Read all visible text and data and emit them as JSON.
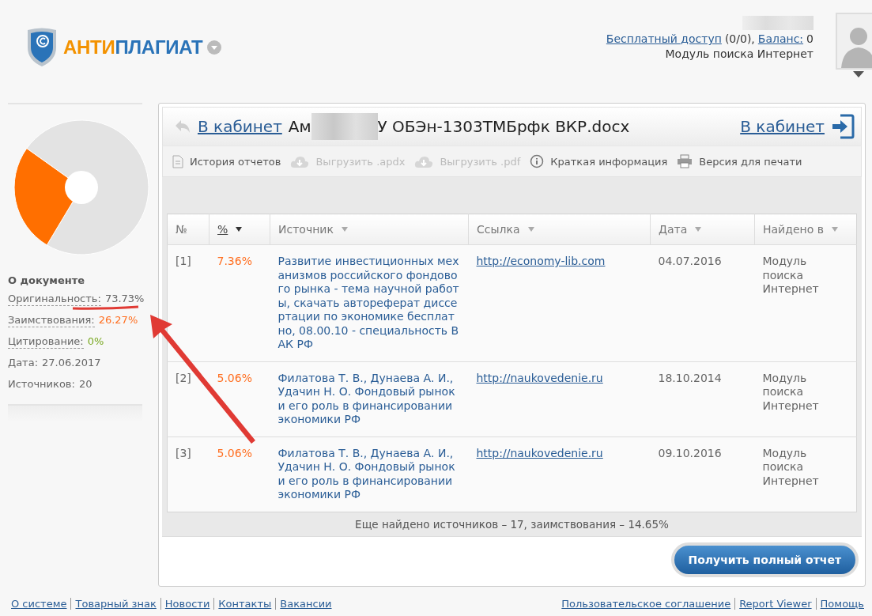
{
  "logo": {
    "text_1": "АНТИ",
    "text_2": "ПЛАГИАТ"
  },
  "header": {
    "free_access_link": "Бесплатный доступ",
    "free_access_count": "(0/0),",
    "balance_link": "Баланс:",
    "balance_value": "0",
    "module": "Модуль поиска Интернет"
  },
  "sidebar": {
    "chart_data": {
      "type": "donut",
      "values": [
        73.73,
        26.27
      ]
    },
    "heading": "О документе",
    "stats": [
      {
        "kind": "term",
        "label": "Оригинальность:",
        "value": "73.73%",
        "color": "#666666"
      },
      {
        "kind": "term",
        "label": "Заимствования:",
        "value": "26.27%",
        "color": "#ff6f21"
      },
      {
        "kind": "term",
        "label": "Цитирование:",
        "value": "0%",
        "color": "#79a821"
      },
      {
        "kind": "plain",
        "label": "Дата:",
        "value": "27.06.2017",
        "color": "#666666"
      },
      {
        "kind": "plain",
        "label": "Источников:",
        "value": "20",
        "color": "#666666"
      }
    ]
  },
  "report": {
    "back_link": "В кабинет",
    "title_start": "Ам",
    "title_end": "У ОБЭн-1303ТМБрфк ВКР.docx",
    "exit_link": "В кабинет",
    "toolbar": [
      {
        "kind": "document",
        "label": "История отчетов",
        "disabled": false
      },
      {
        "kind": "cloud",
        "label": "Выгрузить .apdx",
        "disabled": true
      },
      {
        "kind": "cloud",
        "label": "Выгрузить .pdf",
        "disabled": true
      },
      {
        "kind": "info",
        "label": "Краткая информация",
        "disabled": false
      },
      {
        "kind": "printer",
        "label": "Версия для печати",
        "disabled": false
      }
    ],
    "table": {
      "columns": [
        {
          "label": "№",
          "sortable": false,
          "selected": false
        },
        {
          "label": "%",
          "sortable": true,
          "selected": true
        },
        {
          "label": "Источник",
          "sortable": true,
          "selected": false
        },
        {
          "label": "Ссылка",
          "sortable": true,
          "selected": false
        },
        {
          "label": "Дата",
          "sortable": true,
          "selected": false
        },
        {
          "label": "Найдено в",
          "sortable": true,
          "selected": false
        }
      ],
      "rows": [
        {
          "number": "[1]",
          "percent": "7.36%",
          "source": "Развитие инвестиционных механизмов российского фондового рынка - тема научной работы, скачать автореферат диссертации по экономике бесплатно, 08.00.10 - специальность ВАК РФ",
          "link": "http://economy-lib.com",
          "date": "04.07.2016",
          "found_in": "Модуль поиска Интернет"
        },
        {
          "number": "[2]",
          "percent": "5.06%",
          "source": "Филатова Т. В., Дунаева А. И., Удачин Н. О. Фондовый рынок и его роль в финансировании экономики РФ",
          "link": "http://naukovedenie.ru",
          "date": "18.10.2014",
          "found_in": "Модуль поиска Интернет"
        },
        {
          "number": "[3]",
          "percent": "5.06%",
          "source": "Филатова Т. В., Дунаева А. И., Удачин Н. О. Фондовый рынок и его роль в финансировании экономики РФ",
          "link": "http://naukovedenie.ru",
          "date": "09.10.2016",
          "found_in": "Модуль поиска Интернет"
        }
      ]
    },
    "more_sources": "Еще найдено источников – 17, заимствования – 14.65%",
    "full_report_button": "Получить полный отчет"
  },
  "footer": {
    "left_links": [
      "О системе",
      "Товарный знак",
      "Новости",
      "Контакты",
      "Вакансии"
    ],
    "right_links": [
      "Пользовательское соглашение",
      "Report Viewer",
      "Помощь"
    ]
  }
}
